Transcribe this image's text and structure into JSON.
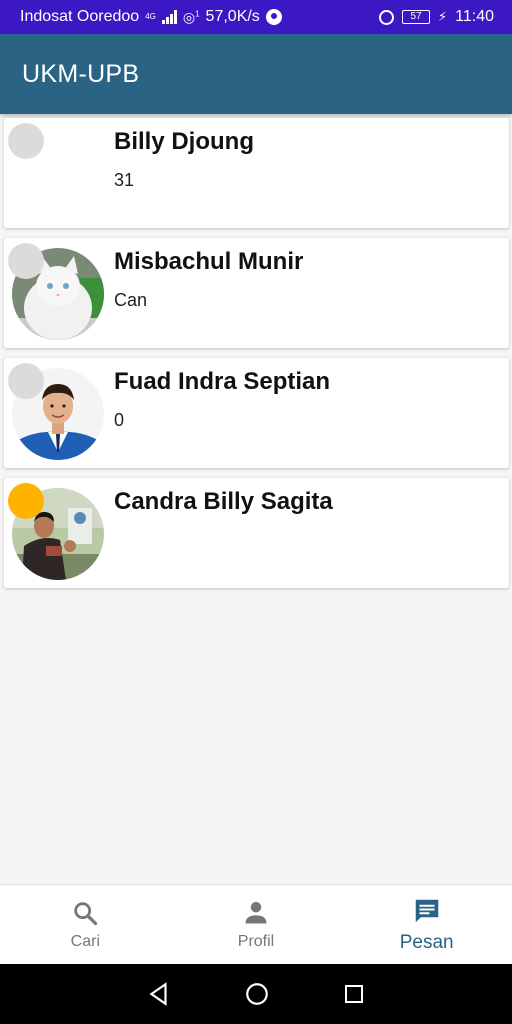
{
  "status_bar": {
    "carrier": "Indosat Ooredoo",
    "network": "4G",
    "hotspot_badge": "1",
    "speed": "57,0K/s",
    "battery": "57",
    "time": "11:40"
  },
  "app_bar": {
    "title": "UKM-UPB"
  },
  "chats": [
    {
      "name": "Billy Djoung",
      "last_message": "31",
      "status_color": "#dcdada",
      "avatar": "none"
    },
    {
      "name": "Misbachul Munir",
      "last_message": "Can",
      "status_color": "#dcdada",
      "avatar": "white-cat"
    },
    {
      "name": "Fuad Indra Septian",
      "last_message": "0",
      "status_color": "#dcdada",
      "avatar": "man-blue-suit"
    },
    {
      "name": "Candra Billy Sagita",
      "last_message": "",
      "status_color": "#ffb300",
      "avatar": "man-outdoor"
    }
  ],
  "bottom_nav": {
    "items": [
      {
        "label": "Cari",
        "icon": "search-icon",
        "active": false
      },
      {
        "label": "Profil",
        "icon": "person-icon",
        "active": false
      },
      {
        "label": "Pesan",
        "icon": "message-icon",
        "active": true
      }
    ]
  },
  "colors": {
    "status_bar": "#3b18c4",
    "app_bar": "#2a6384",
    "nav_active": "#2a6384",
    "nav_inactive": "#777777",
    "status_online": "#ffb300",
    "status_offline": "#dcdada"
  }
}
